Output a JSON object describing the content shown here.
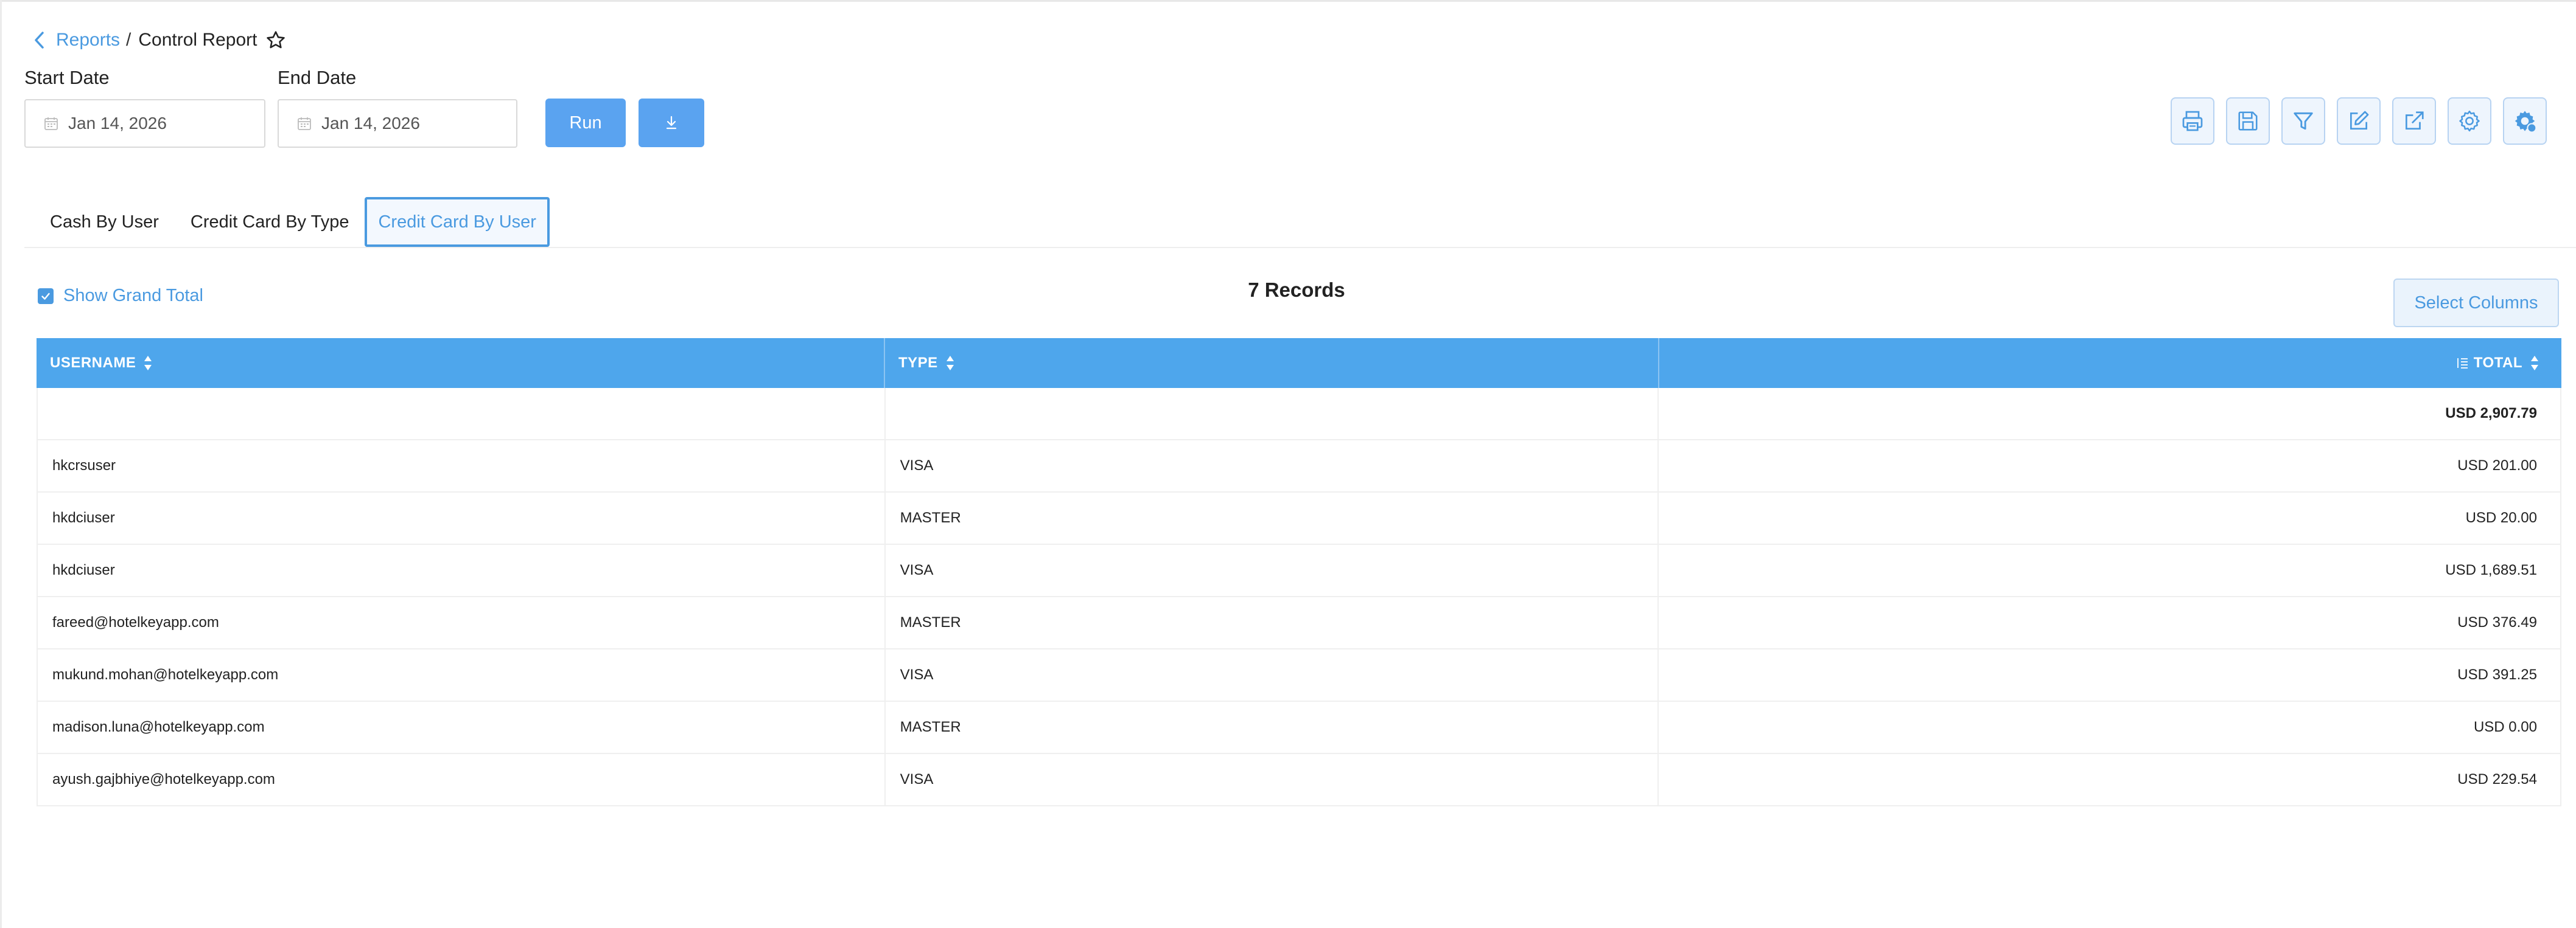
{
  "breadcrumb": {
    "parent": "Reports",
    "separator": "/",
    "current": "Control Report"
  },
  "filters": {
    "start_label": "Start Date",
    "start_value": "Jan 14, 2026",
    "end_label": "End Date",
    "end_value": "Jan 14, 2026",
    "run_label": "Run"
  },
  "toolbar_icons": [
    "print-icon",
    "save-icon",
    "filter-icon",
    "edit-icon",
    "external-link-icon",
    "settings-icon",
    "gear-badge-icon"
  ],
  "tabs": [
    {
      "label": "Cash By User",
      "active": false
    },
    {
      "label": "Credit Card By Type",
      "active": false
    },
    {
      "label": "Credit Card By User",
      "active": true
    }
  ],
  "grand_total_toggle": {
    "label": "Show Grand Total",
    "checked": true
  },
  "records_label": "7 Records",
  "select_columns_label": "Select Columns",
  "table": {
    "headers": [
      "USERNAME",
      "TYPE",
      "TOTAL"
    ],
    "total_row": {
      "username": "",
      "type": "",
      "total": "USD 2,907.79"
    },
    "rows": [
      {
        "username": "hkcrsuser",
        "type": "VISA",
        "total": "USD 201.00"
      },
      {
        "username": "hkdciuser",
        "type": "MASTER",
        "total": "USD 20.00"
      },
      {
        "username": "hkdciuser",
        "type": "VISA",
        "total": "USD 1,689.51"
      },
      {
        "username": "fareed@hotelkeyapp.com",
        "type": "MASTER",
        "total": "USD 376.49"
      },
      {
        "username": "mukund.mohan@hotelkeyapp.com",
        "type": "VISA",
        "total": "USD 391.25"
      },
      {
        "username": "madison.luna@hotelkeyapp.com",
        "type": "MASTER",
        "total": "USD 0.00"
      },
      {
        "username": "ayush.gajbhiye@hotelkeyapp.com",
        "type": "VISA",
        "total": "USD 229.54"
      }
    ]
  },
  "colors": {
    "accent": "#4a9ae0",
    "button": "#5aa3f0",
    "table_header": "#4ea6ec"
  }
}
